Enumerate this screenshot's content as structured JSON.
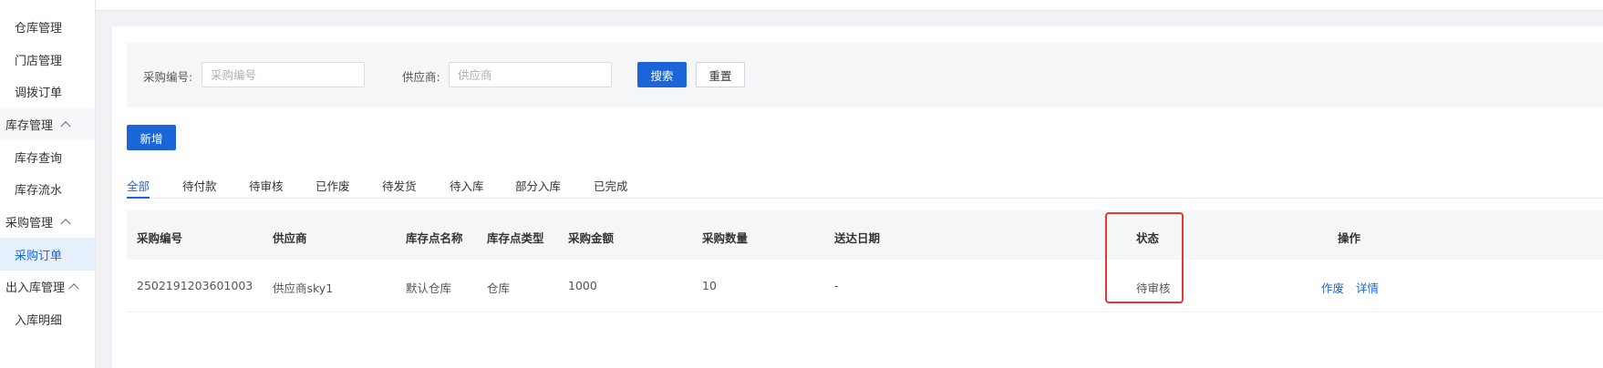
{
  "sidebar": {
    "items": [
      {
        "label": "仓库管理",
        "kind": "sub"
      },
      {
        "label": "门店管理",
        "kind": "sub"
      },
      {
        "label": "调拨订单",
        "kind": "sub"
      },
      {
        "label": "库存管理",
        "kind": "group"
      },
      {
        "label": "库存查询",
        "kind": "sub"
      },
      {
        "label": "库存流水",
        "kind": "sub"
      },
      {
        "label": "采购管理",
        "kind": "group"
      },
      {
        "label": "采购订单",
        "kind": "sub",
        "active": true
      },
      {
        "label": "出入库管理",
        "kind": "group"
      },
      {
        "label": "入库明细",
        "kind": "sub"
      }
    ]
  },
  "filter": {
    "purchase_no_label": "采购编号:",
    "purchase_no_placeholder": "采购编号",
    "purchase_no_value": "",
    "supplier_label": "供应商:",
    "supplier_placeholder": "供应商",
    "supplier_value": "",
    "search_label": "搜索",
    "reset_label": "重置"
  },
  "toolbar": {
    "add_label": "新增"
  },
  "tabs": [
    {
      "label": "全部",
      "active": true
    },
    {
      "label": "待付款"
    },
    {
      "label": "待审核"
    },
    {
      "label": "已作废"
    },
    {
      "label": "待发货"
    },
    {
      "label": "待入库"
    },
    {
      "label": "部分入库"
    },
    {
      "label": "已完成"
    }
  ],
  "table": {
    "columns": [
      "采购编号",
      "供应商",
      "库存点名称",
      "库存点类型",
      "采购金额",
      "采购数量",
      "送达日期",
      "状态",
      "操作"
    ],
    "rows": [
      {
        "cells": [
          "2502191203601003",
          "供应商sky1",
          "默认仓库",
          "仓库",
          "1000",
          "10",
          "-",
          "待审核"
        ],
        "actions": [
          "作废",
          "详情"
        ]
      }
    ]
  },
  "colors": {
    "accent": "#1a66d9",
    "highlight": "#e53935"
  }
}
